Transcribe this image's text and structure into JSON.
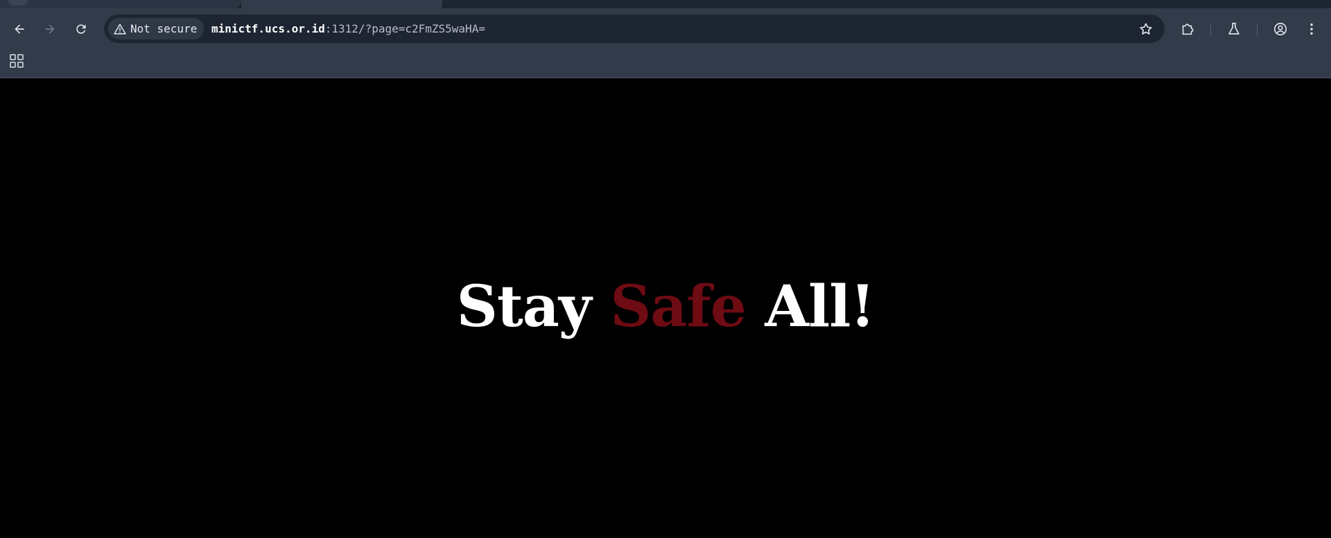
{
  "browser": {
    "security_label": "Not secure",
    "url_host": "minictf.ucs.or.id",
    "url_rest": ":1312/?page=c2FmZS5waHA=",
    "icons": {
      "back": "arrow-left-icon",
      "forward": "arrow-right-icon",
      "reload": "reload-icon",
      "warning": "warning-triangle-icon",
      "bookmark": "star-icon",
      "extensions": "puzzle-icon",
      "labs": "flask-icon",
      "profile": "account-circle-icon",
      "menu": "kebab-menu-icon",
      "apps": "apps-grid-icon"
    },
    "colors": {
      "toolbar": "#323b4a",
      "omnibox": "#1e2532",
      "tabstrip": "#1b222d"
    }
  },
  "page": {
    "headline_part1": "Stay ",
    "headline_part2": "Safe",
    "headline_part3": " All!",
    "colors": {
      "background": "#000000",
      "text": "#ffffff",
      "accent": "#6e0b13"
    }
  }
}
